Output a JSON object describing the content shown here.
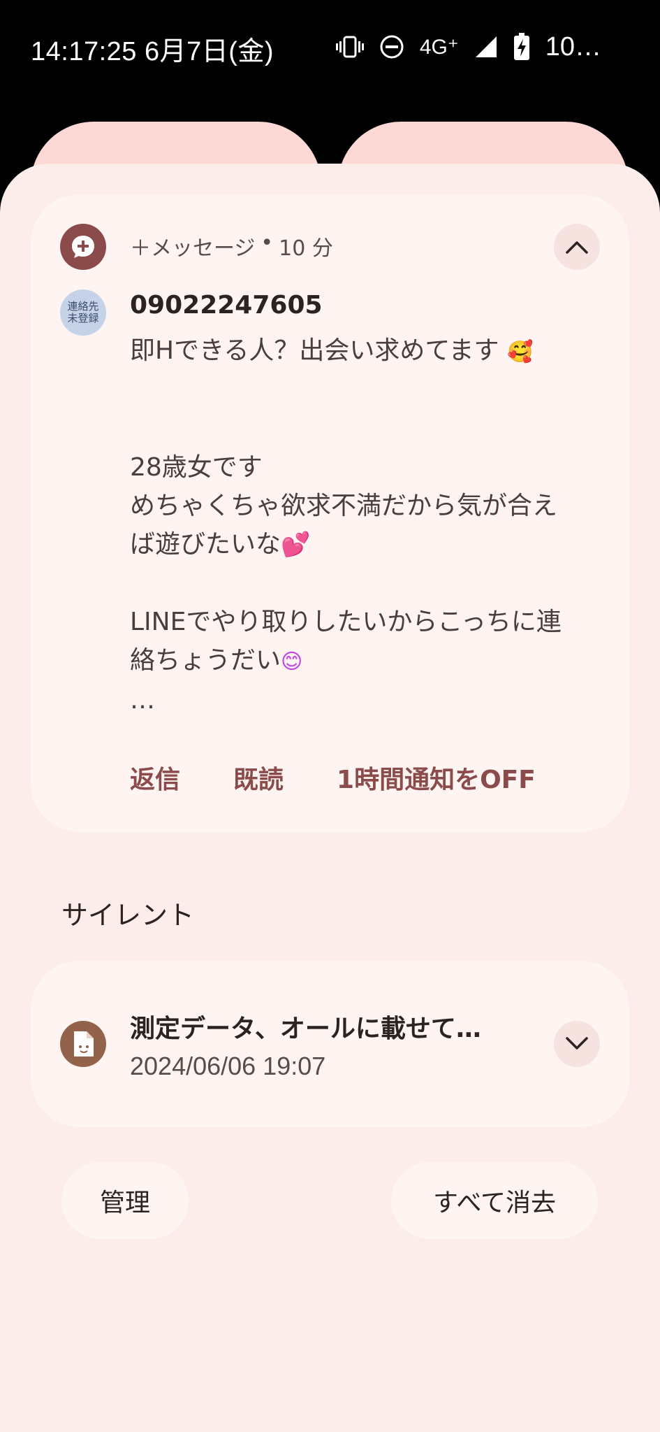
{
  "status_bar": {
    "time_date": "14:17:25 6月7日(金)",
    "network": "4G⁺",
    "battery": "10…",
    "icons": [
      "vibrate-icon",
      "dnd-icon",
      "network-4g-icon",
      "signal-icon",
      "battery-charging-icon"
    ]
  },
  "notification": {
    "app_header": {
      "app_name": "＋メッセージ",
      "separator": "•",
      "age": "10 分"
    },
    "avatar_text": [
      "連絡先",
      "未登録"
    ],
    "sender": "09022247605",
    "message_lines": [
      "即Hできる人？出会い求めてます",
      "",
      "",
      "28歳女です",
      "めちゃくちゃ欲求不満だから気が合え",
      "ば遊びたいな",
      "",
      "LINEでやり取りしたいからこっちに連",
      "絡ちょうだい",
      "…"
    ],
    "emoji": {
      "line1": "🥰",
      "line6": "💕",
      "line9": "😊"
    },
    "actions": {
      "reply": "返信",
      "mark_read": "既読",
      "mute": "1時間通知をOFF"
    }
  },
  "silent_section": {
    "label": "サイレント",
    "item": {
      "title": "測定データ、オールに載せて…",
      "time": "2024/06/06 19:07"
    }
  },
  "footer": {
    "manage": "管理",
    "clear_all": "すべて消去"
  },
  "colors": {
    "shade_bg": "#fcecea",
    "card_bg": "#fef5f3",
    "accent": "#8c4b4b",
    "qs_tile": "#fdd9d6"
  }
}
